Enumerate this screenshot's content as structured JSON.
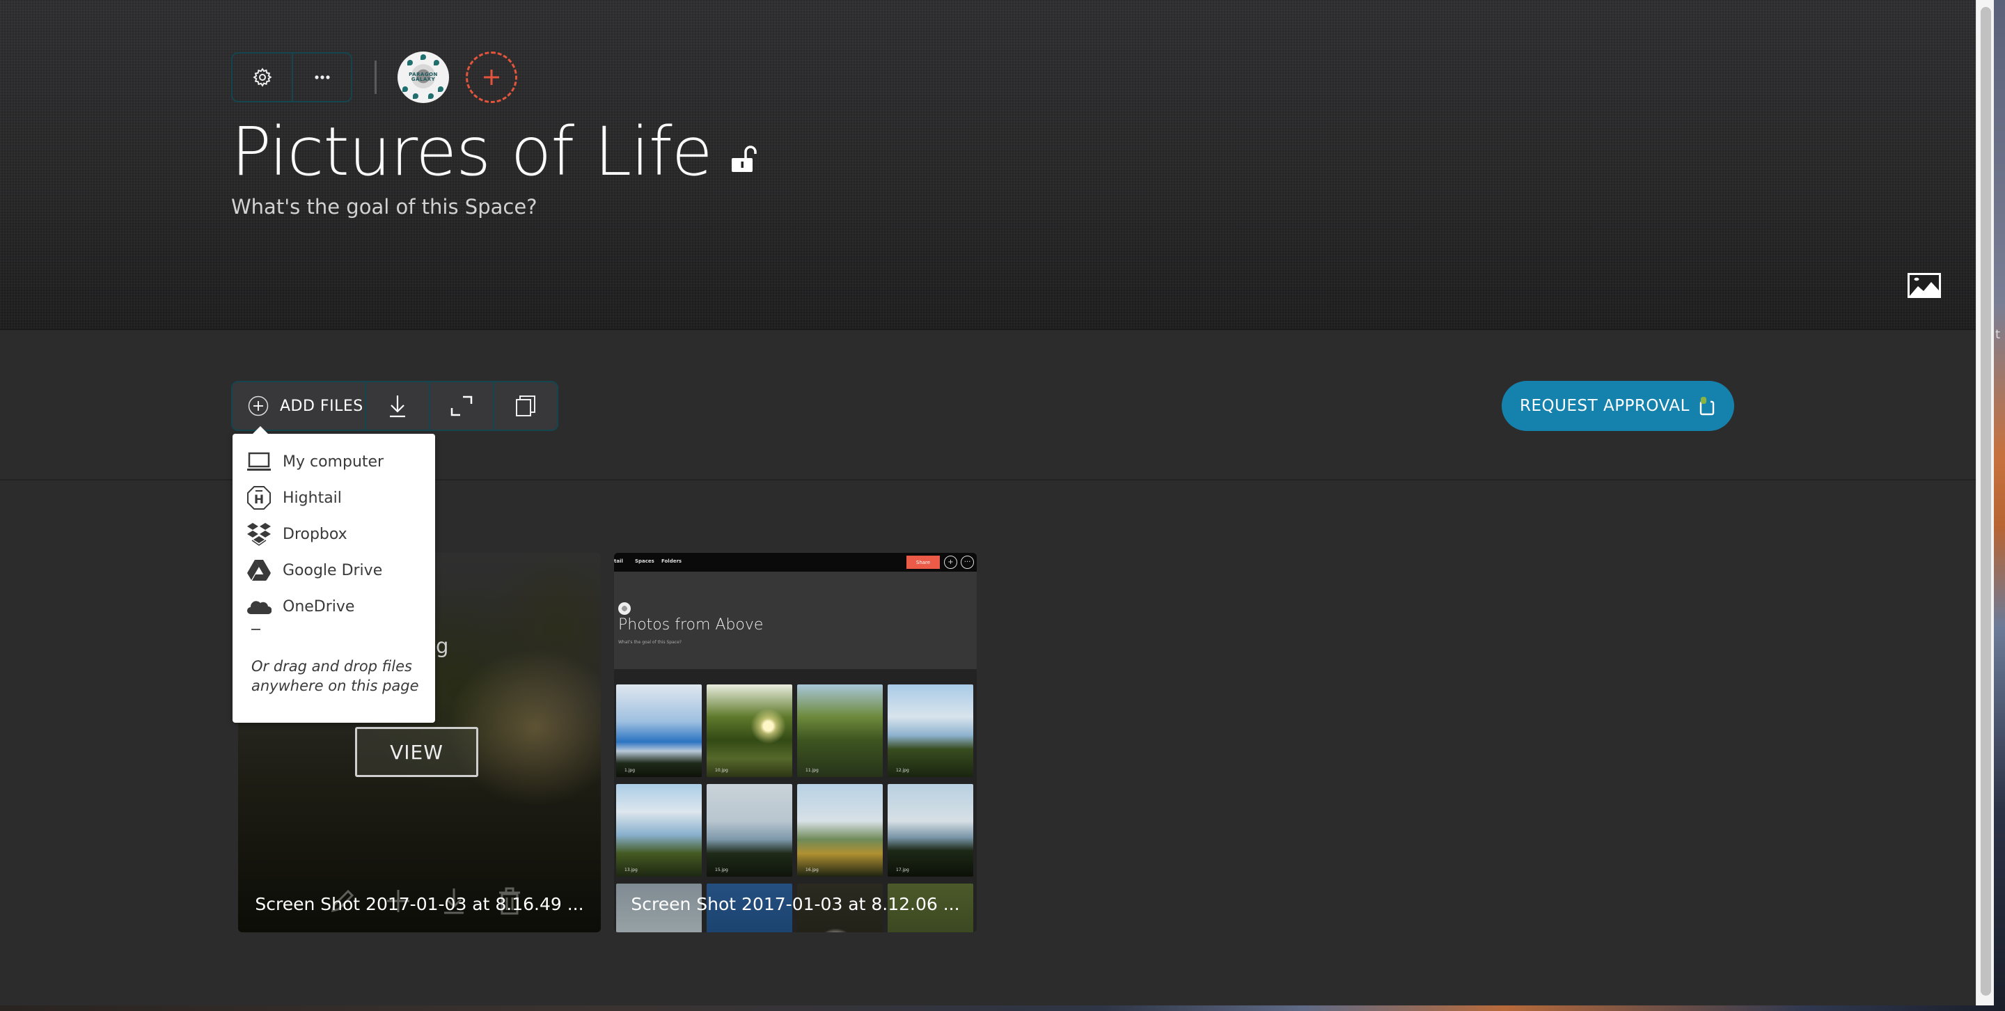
{
  "header": {
    "settings_button_icon": "gear-icon",
    "more_button_icon": "ellipsis-icon",
    "avatar_text": "PARAGON GALAXY",
    "add_member_icon": "plus-icon",
    "title": "Pictures of Life",
    "lock_icon": "unlocked-padlock-icon",
    "goal_placeholder": "What's the goal of this Space?",
    "cover_image_icon": "image-icon"
  },
  "toolbar": {
    "add_files_label": "ADD FILES",
    "download_icon": "download-icon",
    "expand_icon": "expand-icon",
    "copy_icon": "copy-icon",
    "request_approval_label": "REQUEST APPROVAL",
    "accent_color": "#1581ad",
    "toolbar_border_color": "#15454f"
  },
  "add_files_menu": {
    "items": [
      {
        "label": "My computer",
        "icon": "laptop-icon"
      },
      {
        "label": "Hightail",
        "icon": "hightail-icon"
      },
      {
        "label": "Dropbox",
        "icon": "dropbox-icon"
      },
      {
        "label": "Google Drive",
        "icon": "google-drive-icon"
      },
      {
        "label": "OneDrive",
        "icon": "onedrive-icon"
      }
    ],
    "separator": "–",
    "hint": "Or drag and drop files anywhere on this page"
  },
  "files": [
    {
      "name": "Screen Shot 2017-01-03 at 8.16.49 ...",
      "peek_text": "g",
      "view_label": "VIEW",
      "actions": [
        "edit-icon",
        "add-icon",
        "download-icon",
        "trash-icon"
      ]
    },
    {
      "name": "Screen Shot 2017-01-03 at 8.12.06 ...",
      "preview": {
        "nav_items": [
          "tail",
          "Spaces",
          "Folders"
        ],
        "share_label": "Share",
        "plus_glyph": "+",
        "more_glyph": "···",
        "title": "Photos from Above",
        "goal": "What's the goal of this Space?",
        "thumbnails": [
          "1.jpg",
          "10.jpg",
          "11.jpg",
          "12.jpg",
          "13.jpg",
          "15.jpg",
          "16.jpg",
          "17.jpg",
          "",
          "",
          "",
          ""
        ]
      }
    }
  ],
  "desktop": {
    "edge_glyph": "t"
  }
}
